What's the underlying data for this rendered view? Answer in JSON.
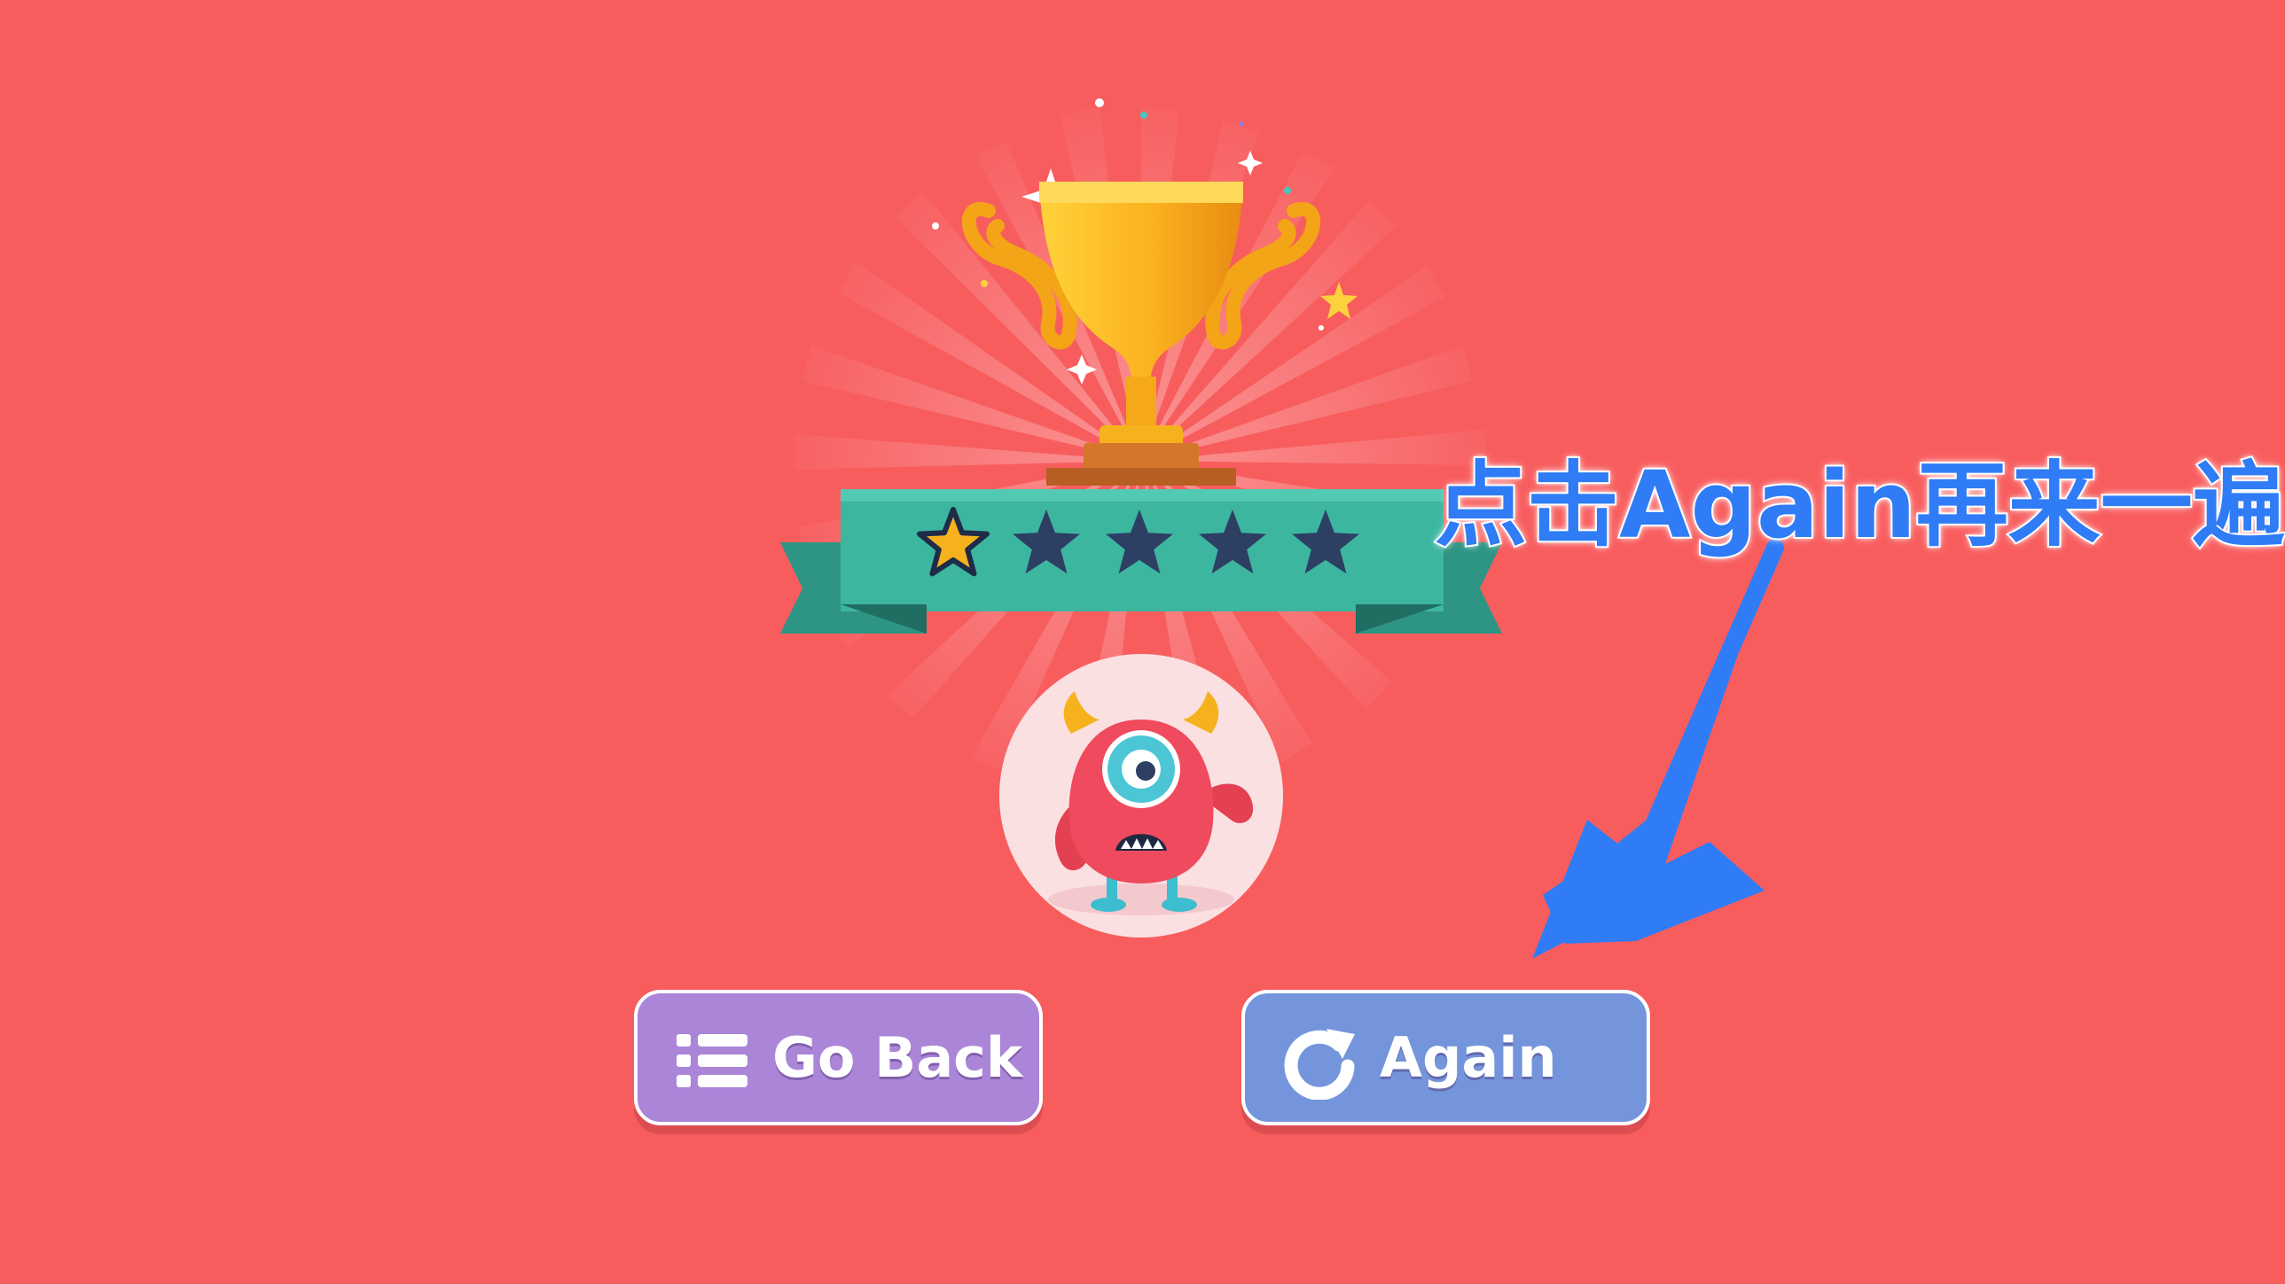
{
  "rating": {
    "earned_stars": 1,
    "total_stars": 5
  },
  "buttons": {
    "go_back_label": "Go Back",
    "again_label": "Again"
  },
  "annotation": {
    "text": "点击Again再来一遍"
  },
  "icons": {
    "trophy": "trophy-icon",
    "star": "star-icon",
    "monster": "monster-avatar",
    "list": "list-icon",
    "replay": "replay-icon",
    "arrow": "arrow-icon"
  },
  "colors": {
    "background": "#f85d5e",
    "ribbon": "#3db6a0",
    "star_earned": "#f6b21c",
    "star_empty": "#2d3f63",
    "go_back_button": "#ab85d8",
    "again_button": "#7495db",
    "annotation": "#2f7cf6"
  }
}
